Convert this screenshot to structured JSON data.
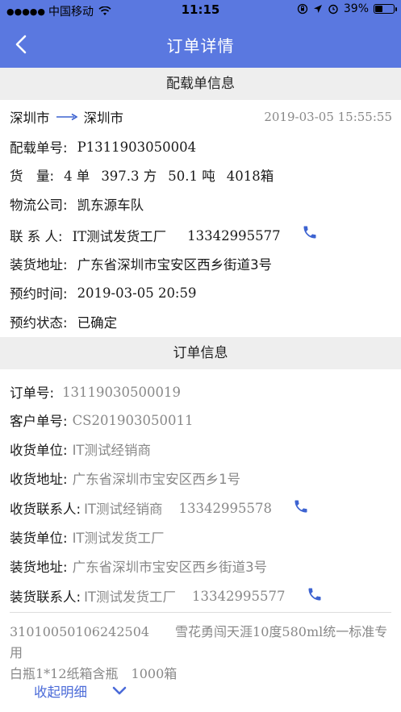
{
  "status_bar": {
    "carrier": "中国移动",
    "signal_dots": "●●●●●",
    "time": "11:15",
    "battery": "39%",
    "battery_level": 0.39
  },
  "nav": {
    "title": "订单详情"
  },
  "loading_section": {
    "header": "配载单信息",
    "from_city": "深圳市",
    "to_city": "深圳市",
    "datetime": "2019-03-05 15:55:55",
    "load_no_label": "配载单号:",
    "load_no": "P1311903050004",
    "cargo_label": "货　量:",
    "cargo_orders": "4 单",
    "cargo_volume": "397.3 方",
    "cargo_weight": "50.1 吨",
    "cargo_boxes": "4018箱",
    "logistics_label": "物流公司:",
    "logistics": "凯东源车队",
    "contact_label": "联 系 人:",
    "contact_name": "IT测试发货工厂",
    "contact_phone": "13342995577",
    "address_label": "装货地址:",
    "address": "广东省深圳市宝安区西乡街道3号",
    "appoint_time_label": "预约时间:",
    "appoint_time": "2019-03-05 20:59",
    "appoint_status_label": "预约状态:",
    "appoint_status": "已确定"
  },
  "order_section": {
    "header": "订单信息",
    "order_no_label": "订单号:",
    "order_no": "13119030500019",
    "customer_no_label": "客户单号:",
    "customer_no": "CS201903050011",
    "receiver_label": "收货单位:",
    "receiver": "IT测试经销商",
    "receiver_address_label": "收货地址:",
    "receiver_address": "广东省深圳市宝安区西乡1号",
    "receiver_contact_label": "收货联系人:",
    "receiver_contact_name": "IT测试经销商",
    "receiver_contact_phone": "13342995578",
    "shipper_label": "装货单位:",
    "shipper": "IT测试发货工厂",
    "shipper_address_label": "装货地址:",
    "shipper_address": "广东省深圳市宝安区西乡街道3号",
    "shipper_contact_label": "装货联系人:",
    "shipper_contact_name": "IT测试发货工厂",
    "shipper_contact_phone": "13342995577"
  },
  "product": {
    "line1": "31010050106242504　　雪花勇闯天涯10度580ml统一标准专用",
    "line2": "白瓶1*12纸箱含瓶　1000箱"
  },
  "collapse": {
    "label": "收起明细"
  },
  "colors": {
    "brand": "#5a78e0",
    "link": "#4a6ad8",
    "phone_icon": "#3d63d1",
    "section_bg": "#eeeeee"
  },
  "icons": {
    "back": "chevron-left-icon",
    "route": "arrow-right-icon",
    "phone": "phone-icon",
    "collapse": "chevron-down-icon"
  }
}
